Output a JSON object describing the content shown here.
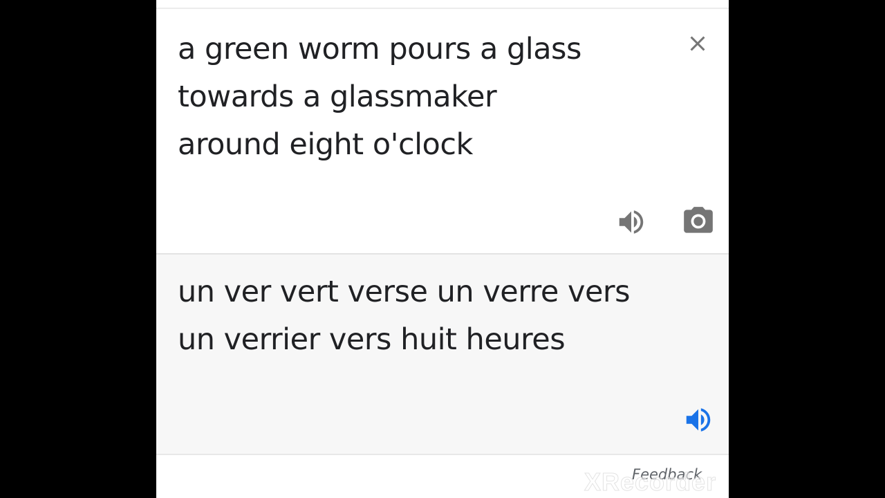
{
  "source": {
    "text": "a green worm pours a glass\ntowards a glassmaker\naround eight o'clock"
  },
  "target": {
    "text": "un ver vert verse un verre vers\nun verrier vers huit heures"
  },
  "footer": {
    "feedback_label": "Feedback"
  },
  "watermark": {
    "text": "XRecorder"
  },
  "icons": {
    "close": "close-icon",
    "source_speaker": "speaker-icon",
    "camera": "camera-icon",
    "target_speaker": "speaker-icon"
  },
  "colors": {
    "text": "#202124",
    "icon_gray": "#757575",
    "accent_blue": "#1a73e8",
    "target_background": "#f7f7f7"
  }
}
